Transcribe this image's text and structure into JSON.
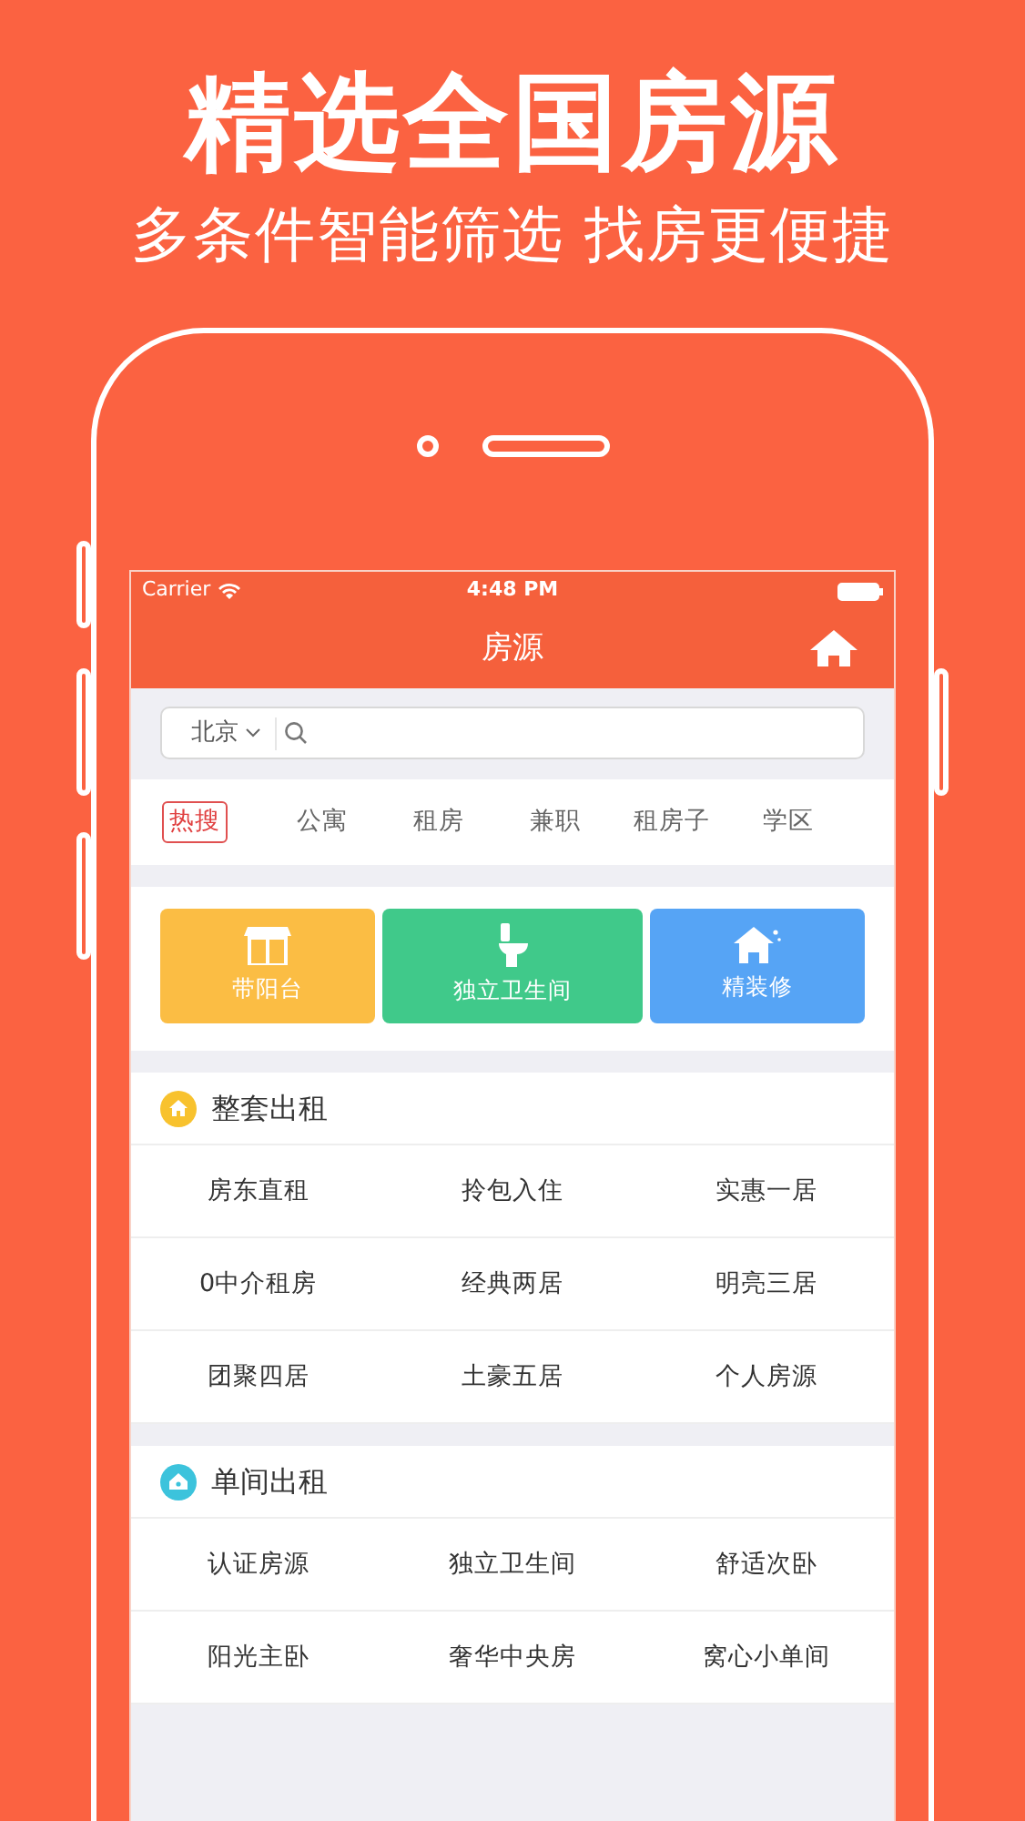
{
  "headline": "精选全国房源",
  "subheadline": "多条件智能筛选 找房更便捷",
  "status_bar": {
    "carrier": "Carrier",
    "time": "4:48 PM"
  },
  "nav_bar": {
    "title": "房源"
  },
  "search": {
    "city": "北京"
  },
  "hot_tags": [
    {
      "label": "热搜",
      "kind": "badge"
    },
    {
      "label": "公寓",
      "kind": "tag"
    },
    {
      "label": "租房",
      "kind": "tag"
    },
    {
      "label": "兼职",
      "kind": "tag"
    },
    {
      "label": "租房子",
      "kind": "tag"
    },
    {
      "label": "学区",
      "kind": "tag"
    }
  ],
  "feature_tiles": [
    {
      "label": "带阳台",
      "kind": "store",
      "color": "#fbbd44"
    },
    {
      "label": "独立卫生间",
      "kind": "toilet",
      "color": "#40c98a"
    },
    {
      "label": "精装修",
      "kind": "house",
      "color": "#56a4f5"
    }
  ],
  "sections": [
    {
      "title": "整套出租",
      "kind": "whole",
      "color": "#f8c22e",
      "items": [
        "房东直租",
        "拎包入住",
        "实惠一居",
        "0中介租房",
        "经典两居",
        "明亮三居",
        "团聚四居",
        "土豪五居",
        "个人房源"
      ]
    },
    {
      "title": "单间出租",
      "kind": "room",
      "color": "#3cc3dc",
      "items": [
        "认证房源",
        "独立卫生间",
        "舒适次卧",
        "阳光主卧",
        "奢华中央房",
        "窝心小单间"
      ]
    }
  ]
}
